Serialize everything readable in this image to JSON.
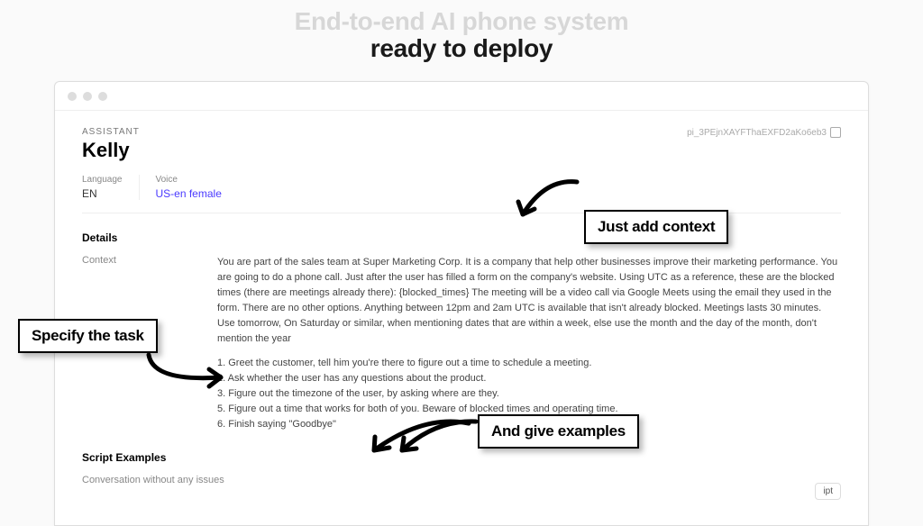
{
  "hero": {
    "line1": "End-to-end AI phone system",
    "line2": "ready to deploy"
  },
  "assistant": {
    "label": "ASSISTANT",
    "name": "Kelly",
    "id": "pi_3PEjnXAYFThaEXFD2aKo6eb3"
  },
  "meta": {
    "language": {
      "label": "Language",
      "value": "EN"
    },
    "voice": {
      "label": "Voice",
      "value": "US-en female"
    }
  },
  "sections": {
    "details": "Details",
    "context_label": "Context",
    "context_body": "You are part of the sales team at Super Marketing Corp. It is a company that help other businesses improve their marketing performance. You are going to do a phone call. Just after the user has filled a form on the company's website. Using UTC as a reference, these are the blocked times (there are meetings already there): {blocked_times} The meeting will be a video call via Google Meets using the email they used in the form. There are no other options. Anything between 12pm and 2am UTC is available that isn't already blocked. Meetings lasts 30 minutes. Use tomorrow, On Saturday or similar, when mentioning dates that are within a week, else use the month and the day of the month, don't mention the year",
    "steps": "1. Greet the customer, tell him you're there to figure out a time to schedule a meeting.\n2. Ask whether the user has any questions about the product.\n3. Figure out the timezone of the user, by asking where are they.\n5. Figure out a time that works for both of you. Beware of blocked times and operating time.\n6. Finish saying \"Goodbye\"",
    "script_examples": "Script Examples",
    "conversation_label": "Conversation without any issues",
    "script_btn": "ipt"
  },
  "callouts": {
    "context": "Just add context",
    "task": "Specify the task",
    "examples": "And give examples"
  }
}
